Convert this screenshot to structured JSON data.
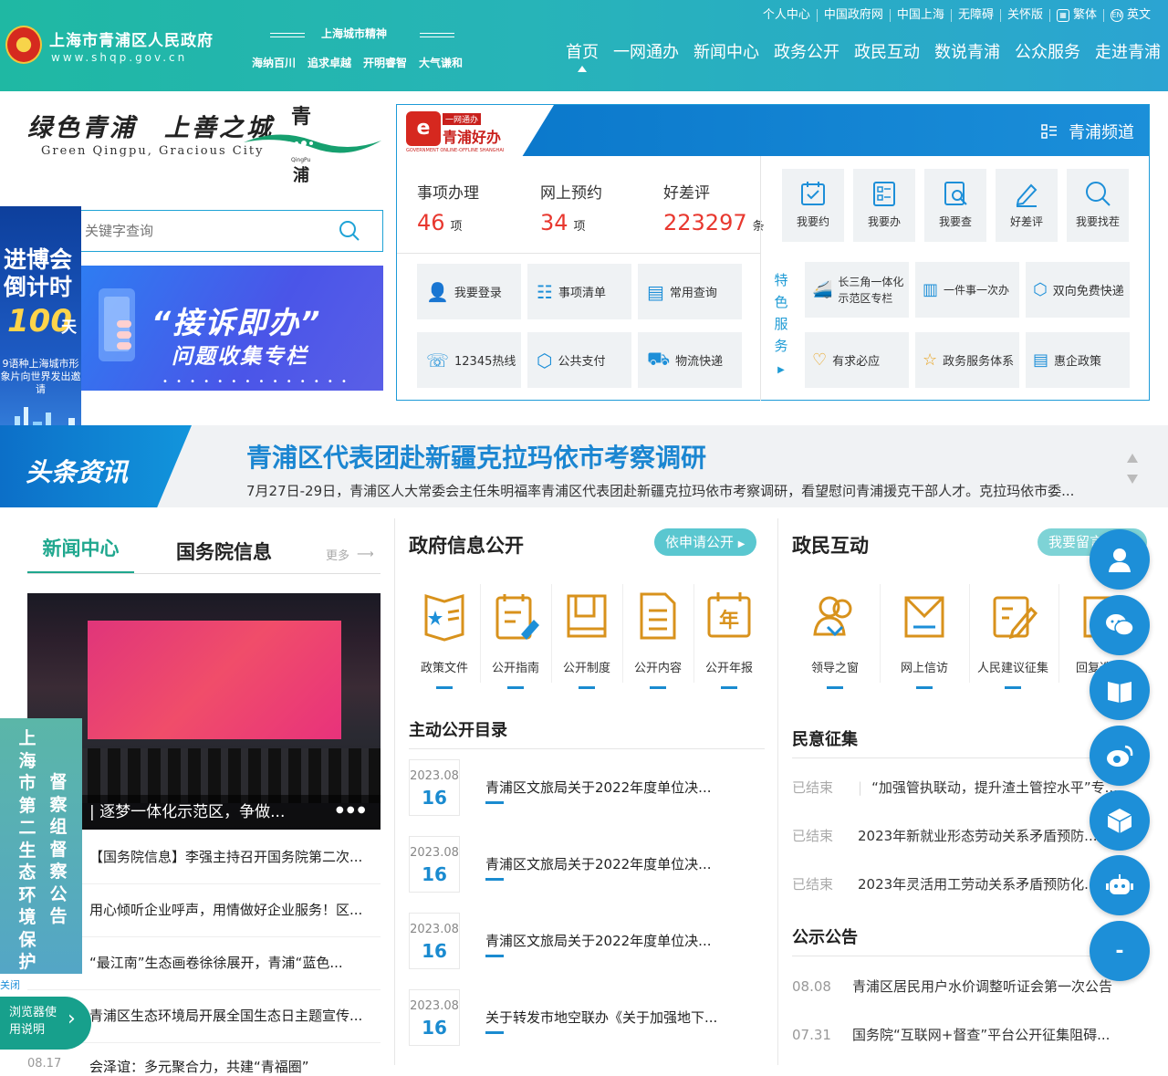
{
  "header": {
    "site_title": "上海市青浦区人民政府",
    "site_domain": "www.shqp.gov.cn",
    "spirit_title": "上海城市精神",
    "spirit_words": [
      "海纳百川",
      "追求卓越",
      "开明睿智",
      "大气谦和"
    ],
    "top_links": [
      "个人中心",
      "中国政府网",
      "中国上海",
      "无障碍",
      "关怀版",
      "繁体",
      "英文"
    ],
    "nav": [
      "首页",
      "一网通办",
      "新闻中心",
      "政务公开",
      "政民互动",
      "数说青浦",
      "公众服务",
      "走进青浦"
    ]
  },
  "brand": {
    "slogan": "绿色青浦　上善之城",
    "slogan_en": "Green Qingpu, Gracious City",
    "logo_char_top": "青",
    "logo_char_bottom": "浦",
    "logo_en": "QingPu"
  },
  "search": {
    "placeholder": "关键字查询"
  },
  "banner": {
    "line1": "“接诉即办”",
    "line2": "问题收集专栏"
  },
  "float_ad": {
    "line1": "进博会",
    "line2": "倒计时",
    "number": "100",
    "unit": "天",
    "sub": "9语种上海城市形象片向世界发出邀请"
  },
  "service": {
    "tag": "一网通办",
    "name": "青浦好办",
    "en": "GOVERNMENT ONLINE-OFFLINE SHANGHAI",
    "channel": "青浦频道",
    "stats": [
      {
        "label": "事项办理",
        "value": "46",
        "unit": "项"
      },
      {
        "label": "网上预约",
        "value": "34",
        "unit": "项"
      },
      {
        "label": "好差评",
        "value": "223297",
        "unit": "条"
      }
    ],
    "quick": [
      "我要约",
      "我要办",
      "我要查",
      "好差评",
      "我要找茬"
    ],
    "tiles": [
      "我要登录",
      "事项清单",
      "常用查询",
      "12345热线",
      "公共支付",
      "物流快递"
    ],
    "special_label": "特色服务",
    "special_tiles": [
      "长三角一体化示范区专栏",
      "一件事一次办",
      "双向免费快递",
      "有求必应",
      "政务服务体系",
      "惠企政策"
    ]
  },
  "headline": {
    "tag": "头条资讯",
    "title": "青浦区代表团赴新疆克拉玛依市考察调研",
    "summary": "7月27日-29日，青浦区人大常委会主任朱明福率青浦区代表团赴新疆克拉玛依市考察调研，看望慰问青浦援克干部人才。克拉玛依市委..."
  },
  "news": {
    "tabs": [
      "新闻中心",
      "国务院信息"
    ],
    "more": "更多",
    "image_caption": "逐梦一体化示范区，争做...",
    "items": [
      "【国务院信息】李强主持召开国务院第二次...",
      "用心倾听企业呼声，用情做好企业服务！区...",
      "“最江南”生态画卷徐徐展开，青浦“蓝色...",
      "青浦区生态环境局开展全国生态日主题宣传...",
      "会泽谊：多元聚合力，共建“青福圈”"
    ],
    "last_date": "08.17"
  },
  "gov_info": {
    "title": "政府信息公开",
    "button": "依申请公开",
    "icons": [
      "政策文件",
      "公开指南",
      "公开制度",
      "公开内容",
      "公开年报"
    ],
    "icon_year_char": "年",
    "directory_title": "主动公开目录",
    "directory": [
      {
        "ym": "2023.08",
        "d": "16",
        "text": "青浦区文旅局关于2022年度单位决..."
      },
      {
        "ym": "2023.08",
        "d": "16",
        "text": "青浦区文旅局关于2022年度单位决..."
      },
      {
        "ym": "2023.08",
        "d": "16",
        "text": "青浦区文旅局关于2022年度单位决..."
      },
      {
        "ym": "2023.08",
        "d": "16",
        "text": "关于转发市地空联办《关于加强地下..."
      }
    ]
  },
  "interaction": {
    "title": "政民互动",
    "button": "我要留言",
    "icons": [
      "领导之窗",
      "网上信访",
      "人民建议征集",
      "回复选登"
    ],
    "opinion_title": "民意征集",
    "opinions": [
      {
        "status": "已结束",
        "text": "“加强管执联动，提升渣土管控水平”专..."
      },
      {
        "status": "已结束",
        "text": "2023年新就业形态劳动关系矛盾预防..."
      },
      {
        "status": "已结束",
        "text": "2023年灵活用工劳动关系矛盾预防化..."
      }
    ],
    "notice_title": "公示公告",
    "notices": [
      {
        "date": "08.08",
        "text": "青浦区居民用户水价调整听证会第一次公告"
      },
      {
        "date": "07.31",
        "text": "国务院“互联网+督查”平台公开征集阻碍..."
      }
    ]
  },
  "left_notice": {
    "col1": "上海市第二生态环境保护",
    "col2": "督察组督察公告",
    "close": "关闭",
    "browser_tip": "浏览器使用说明"
  },
  "colors": {
    "primary": "#1d8fd8",
    "accent": "#1fa78e",
    "red": "#e8382f"
  }
}
